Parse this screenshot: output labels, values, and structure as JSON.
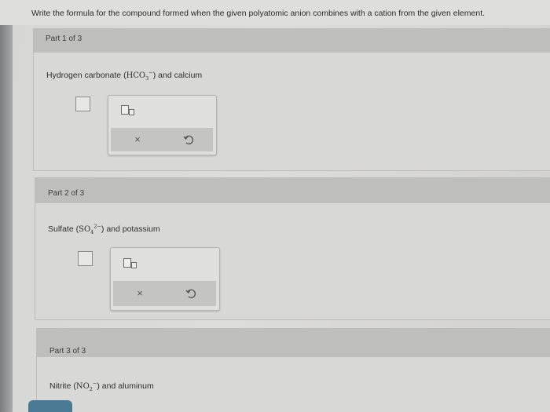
{
  "instructions": "Write the formula for the compound formed when the given polyatomic anion combines with a cation from the given element.",
  "parts": [
    {
      "label": "Part 1 of 3",
      "prompt_start": "Hydrogen carbonate (",
      "formula_base": "HCO",
      "formula_sub": "3",
      "formula_sup": "−",
      "prompt_end": ") and calcium"
    },
    {
      "label": "Part 2 of 3",
      "prompt_start": "Sulfate (",
      "formula_base": "SO",
      "formula_sub": "4",
      "formula_sup": "2−",
      "prompt_end": ") and potassium"
    },
    {
      "label": "Part 3 of 3",
      "prompt_start": "Nitrite (",
      "formula_base": "NO",
      "formula_sub": "2",
      "formula_sup": "−",
      "prompt_end": ") and aluminum"
    }
  ],
  "toolbar": {
    "clear_glyph": "×",
    "clear_icon": "x-icon",
    "undo_icon": "undo-icon",
    "template_icon": "subscript-template-icon"
  },
  "colors": {
    "background": "#d8d8d6",
    "header": "#bebfbd",
    "accent_button": "#4a7a93"
  }
}
